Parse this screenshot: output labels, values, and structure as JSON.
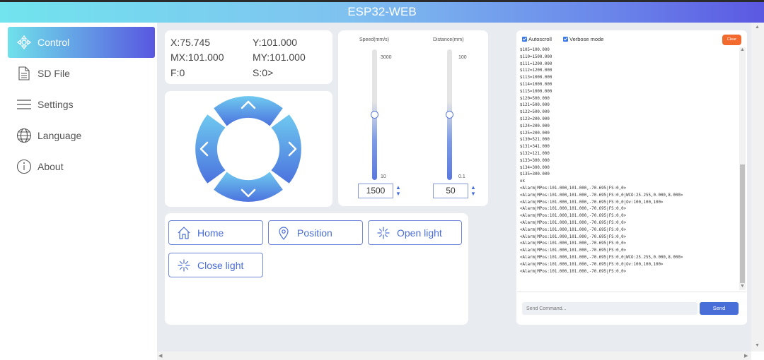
{
  "app": {
    "title": "ESP32-WEB"
  },
  "sidebar": {
    "items": [
      {
        "label": "Control",
        "icon": "control-icon",
        "active": true
      },
      {
        "label": "SD File",
        "icon": "file-icon",
        "active": false
      },
      {
        "label": "Settings",
        "icon": "menu-icon",
        "active": false
      },
      {
        "label": "Language",
        "icon": "globe-icon",
        "active": false
      },
      {
        "label": "About",
        "icon": "info-icon",
        "active": false
      }
    ]
  },
  "position": {
    "x": "X:75.745",
    "y": "Y:101.000",
    "mx": "MX:101.000",
    "my": "MY:101.000",
    "f": "F:0",
    "s": "S:0>"
  },
  "sliders": {
    "speed": {
      "label": "Speed(mm/s)",
      "max": "3000",
      "min": "10",
      "value": "1500",
      "level": 0.5
    },
    "distance": {
      "label": "Distance(mm)",
      "max": "100",
      "min": "0.1",
      "value": "50",
      "level": 0.5
    }
  },
  "actions": {
    "home": "Home",
    "position": "Position",
    "open_light": "Open light",
    "close_light": "Close light"
  },
  "console": {
    "autoscroll": "Autoscroll",
    "verbose": "Verbose mode",
    "clear": "Clear",
    "log": [
      "$105=100.000",
      "$110=1500.000",
      "$111=1200.000",
      "$112=1200.000",
      "$113=1000.000",
      "$114=1000.000",
      "$115=1000.000",
      "$120=500.000",
      "$121=500.000",
      "$122=500.000",
      "$123=200.000",
      "$124=200.000",
      "$125=200.000",
      "$130=521.000",
      "$131=341.000",
      "$132=121.000",
      "$133=300.000",
      "$134=300.000",
      "$135=300.000",
      "ok",
      "<Alarm|MPos:101.000,101.000,-70.695|FS:0,0>",
      "<Alarm|MPos:101.000,101.000,-70.695|FS:0,0|WCO:25.255,0.000,8.000>",
      "<Alarm|MPos:101.000,101.000,-70.695|FS:0,0|Ov:100,100,100>",
      "<Alarm|MPos:101.000,101.000,-70.695|FS:0,0>",
      "<Alarm|MPos:101.000,101.000,-70.695|FS:0,0>",
      "<Alarm|MPos:101.000,101.000,-70.695|FS:0,0>",
      "<Alarm|MPos:101.000,101.000,-70.695|FS:0,0>",
      "<Alarm|MPos:101.000,101.000,-70.695|FS:0,0>",
      "<Alarm|MPos:101.000,101.000,-70.695|FS:0,0>",
      "<Alarm|MPos:101.000,101.000,-70.695|FS:0,0>",
      "<Alarm|MPos:101.000,101.000,-70.695|FS:0,0|WCO:25.255,0.000,8.000>",
      "<Alarm|MPos:101.000,101.000,-70.695|FS:0,0|Ov:100,100,100>",
      "<Alarm|MPos:101.000,101.000,-70.695|FS:0,0>"
    ],
    "input_placeholder": "Send Command...",
    "send": "Send"
  },
  "colors": {
    "accent": "#4a6ed8",
    "clear_button": "#f26a2e",
    "header_start": "#71e4ee",
    "header_end": "#5b58e2"
  }
}
